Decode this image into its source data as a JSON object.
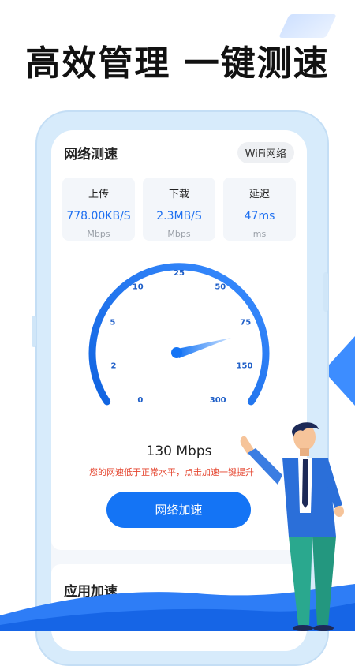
{
  "headline": "高效管理 一键测速",
  "card": {
    "title": "网络测速",
    "wifi_badge": "WiFi网络"
  },
  "stats": [
    {
      "label": "上传",
      "value": "778.00KB/S",
      "unit": "Mbps"
    },
    {
      "label": "下载",
      "value": "2.3MB/S",
      "unit": "Mbps"
    },
    {
      "label": "延迟",
      "value": "47ms",
      "unit": "ms"
    }
  ],
  "gauge": {
    "ticks": [
      "0",
      "2",
      "5",
      "10",
      "25",
      "50",
      "75",
      "150",
      "300"
    ],
    "current_value_mbps": 130
  },
  "speed_text": "130 Mbps",
  "warning": "您的网速低于正常水平，点击加速一键提升",
  "accelerate_button": "网络加速",
  "section2_title": "应用加速",
  "colors": {
    "accent": "#1474f5",
    "warning": "#e5452f",
    "gauge_dark": "#0f63e0",
    "gauge_light": "#9cc8ff"
  }
}
